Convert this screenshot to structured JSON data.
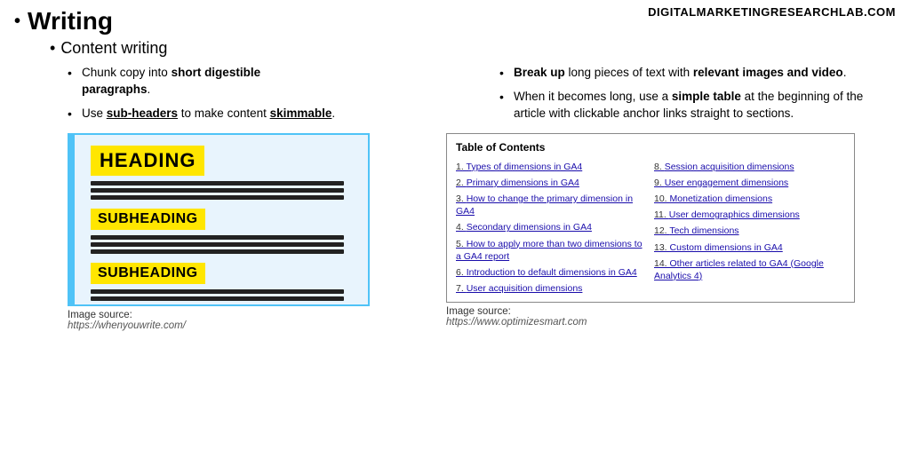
{
  "domain": "DIGITALMARKETINGRESEARCHLAB.COM",
  "main_title": "Writing",
  "sub_title": "Content  writing",
  "left_bullets": [
    {
      "text_plain": "Chunk copy into ",
      "text_bold": "short digestible paragraphs",
      "text_end": "."
    },
    {
      "text_plain": "Use ",
      "text_bold": "sub-headers",
      "text_underline": true,
      "text_end": " to make content ",
      "text_bold2": "skimmable",
      "text_underline2": true,
      "text_end2": "."
    }
  ],
  "right_bullets": [
    {
      "text_bold": "Break up",
      "text_plain": " long pieces of text with ",
      "text_bold2": "relevant images and video",
      "text_end": "."
    },
    {
      "text_plain": "When it becomes long, use a ",
      "text_bold": "simple table",
      "text_end": " at the beginning of the article with clickable anchor links straight to sections."
    }
  ],
  "heading_label": "HEADING",
  "subheading_label": "SUBHEADING",
  "subheading2_label": "SUBHEADING",
  "img_source_left_label": "Image source:",
  "img_source_left_url": "https://whenyouwrite.com/",
  "toc_title": "Table of Contents",
  "toc_items": [
    {
      "num": "1.",
      "text": "Types of dimensions in GA4"
    },
    {
      "num": "8.",
      "text": "Session acquisition dimensions"
    },
    {
      "num": "2.",
      "text": "Primary dimensions in GA4"
    },
    {
      "num": "9.",
      "text": "User engagement dimensions"
    },
    {
      "num": "3.",
      "text": "How to change the primary dimension in GA4"
    },
    {
      "num": "10.",
      "text": "Monetization dimensions"
    },
    {
      "num": "4.",
      "text": "Secondary dimensions in GA4"
    },
    {
      "num": "11.",
      "text": "User demographics dimensions"
    },
    {
      "num": "5.",
      "text": "How to apply more than two dimensions to a GA4 report"
    },
    {
      "num": "12.",
      "text": "Tech dimensions"
    },
    {
      "num": "6.",
      "text": "Introduction to default dimensions in GA4"
    },
    {
      "num": "13.",
      "text": "Custom dimensions in GA4"
    },
    {
      "num": "7.",
      "text": "User acquisition dimensions"
    },
    {
      "num": "14.",
      "text": "Other articles related to GA4 (Google Analytics 4)"
    }
  ],
  "img_source_right_label": "Image source:",
  "img_source_right_url": "https://www.optimizesmart.com"
}
